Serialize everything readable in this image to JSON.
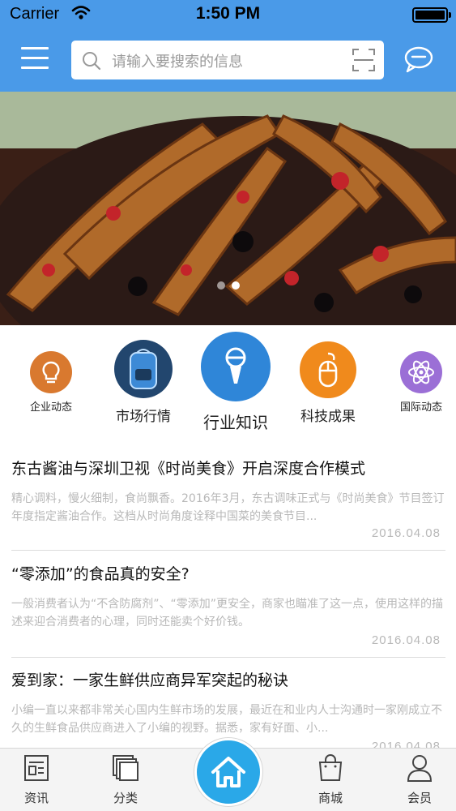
{
  "status_bar": {
    "carrier": "Carrier",
    "time": "1:50 PM"
  },
  "header": {
    "search_placeholder": "请输入要搜索的信息"
  },
  "banner": {
    "page_count": 2,
    "active_index": 1
  },
  "categories": [
    {
      "label": "企业动态",
      "color": "#d9792f"
    },
    {
      "label": "市场行情",
      "color": "#2b5d9a"
    },
    {
      "label": "行业知识",
      "color": "#2f86d8"
    },
    {
      "label": "科技成果",
      "color": "#f08a1c"
    },
    {
      "label": "国际动态",
      "color": "#9b6fd6"
    }
  ],
  "news": [
    {
      "title": "东古酱油与深圳卫视《时尚美食》开启深度合作模式",
      "desc": "精心调料，慢火细制，食尚飘香。2016年3月，东古调味正式与《时尚美食》节目签订年度指定酱油合作。这档从时尚角度诠释中国菜的美食节目...",
      "date": "2016.04.08"
    },
    {
      "title": "“零添加”的食品真的安全?",
      "desc": "一般消费者认为“不含防腐剂”、“零添加”更安全，商家也瞄准了这一点，使用这样的描述来迎合消费者的心理，同时还能卖个好价钱。",
      "date": "2016.04.08"
    },
    {
      "title": "爱到家：一家生鲜供应商异军突起的秘诀",
      "desc": "小编一直以来都非常关心国内生鲜市场的发展，最近在和业内人士沟通时一家刚成立不久的生鲜食品供应商进入了小编的视野。据悉，家有好面、小...",
      "date": "2016.04.08"
    }
  ],
  "tabs": [
    {
      "label": "资讯",
      "icon": "news-icon"
    },
    {
      "label": "分类",
      "icon": "category-icon"
    },
    {
      "label": "",
      "icon": "home-icon"
    },
    {
      "label": "商城",
      "icon": "shopping-bag-icon"
    },
    {
      "label": "会员",
      "icon": "user-icon"
    }
  ],
  "colors": {
    "header": "#4a9ae8",
    "home_button": "#2aa8e8"
  }
}
